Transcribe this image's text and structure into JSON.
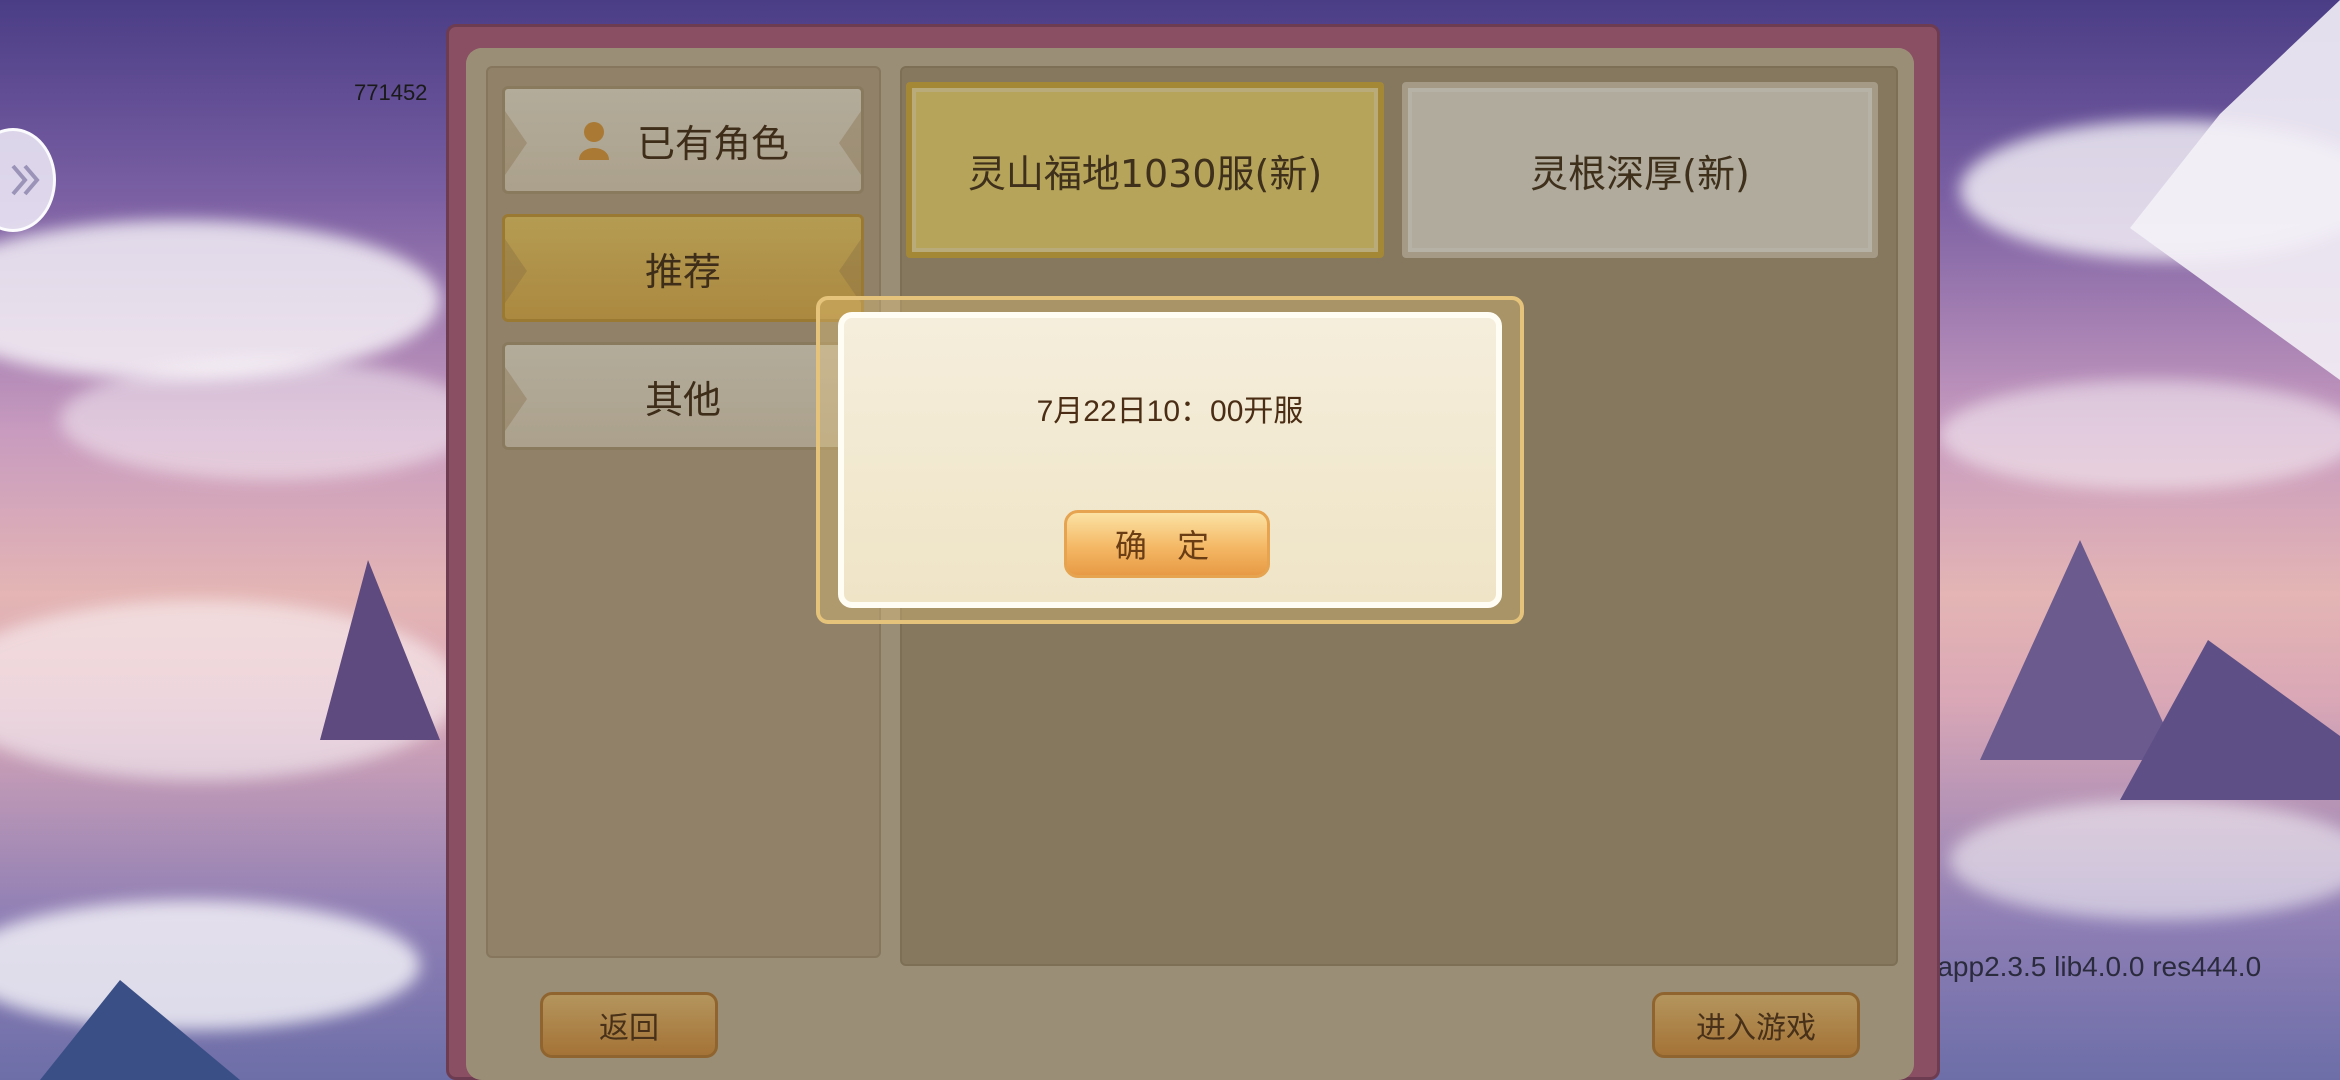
{
  "overlay_text": {
    "build_id": "771452",
    "version": "2 app2.3.5 lib4.0.0 res444.0"
  },
  "icons": {
    "side_toggle": "double-chevron-right-icon",
    "existing_roles": "person-icon"
  },
  "server_panel": {
    "categories": [
      {
        "label": "已有角色",
        "icon": "person-icon",
        "state": "normal"
      },
      {
        "label": "推荐",
        "state": "selected"
      },
      {
        "label": "其他",
        "state": "normal"
      }
    ],
    "servers": [
      {
        "label": "灵山福地1030服(新)",
        "state": "selected"
      },
      {
        "label": "灵根深厚(新)",
        "state": "normal"
      }
    ],
    "back_label": "返回",
    "enter_label": "进入游戏"
  },
  "dialog": {
    "message": "7月22日10：00开服",
    "confirm_label": "确 定"
  },
  "colors": {
    "frame": "#8a4f63",
    "panel": "#c9bba2",
    "selected_gold": "#f2dc74",
    "button_orange": "#e89a45",
    "dialog_bg": "#f5eedc"
  }
}
